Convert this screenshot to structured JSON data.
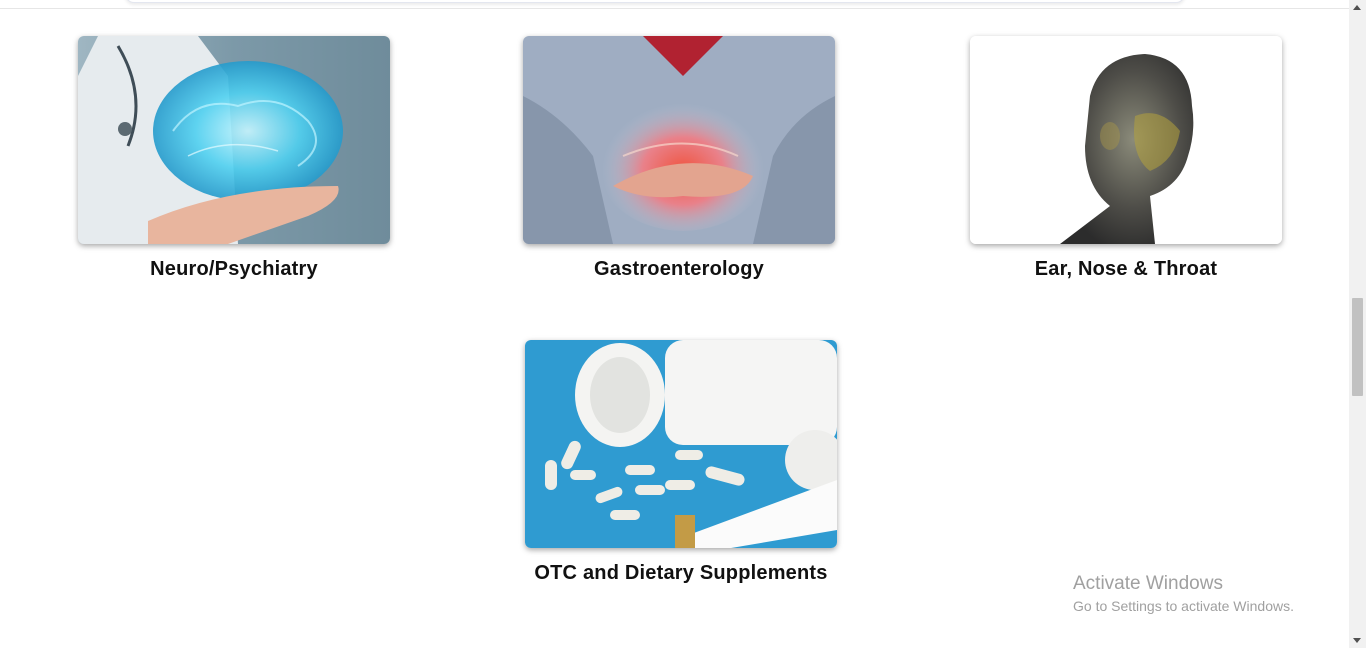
{
  "categories": [
    {
      "label": "Neuro/Psychiatry",
      "image_icon": "brain-hand-image"
    },
    {
      "label": "Gastroenterology",
      "image_icon": "stomach-image"
    },
    {
      "label": "Ear, Nose & Throat",
      "image_icon": "head-xray-image"
    },
    {
      "label": "OTC and Dietary Supplements",
      "image_icon": "pills-tape-image"
    }
  ],
  "watermark": {
    "title": "Activate Windows",
    "subtitle": "Go to Settings to activate Windows."
  },
  "colors": {
    "label_text": "#111111",
    "watermark_text": "#a0a0a0",
    "scrollbar_thumb": "#c1c1c1"
  }
}
